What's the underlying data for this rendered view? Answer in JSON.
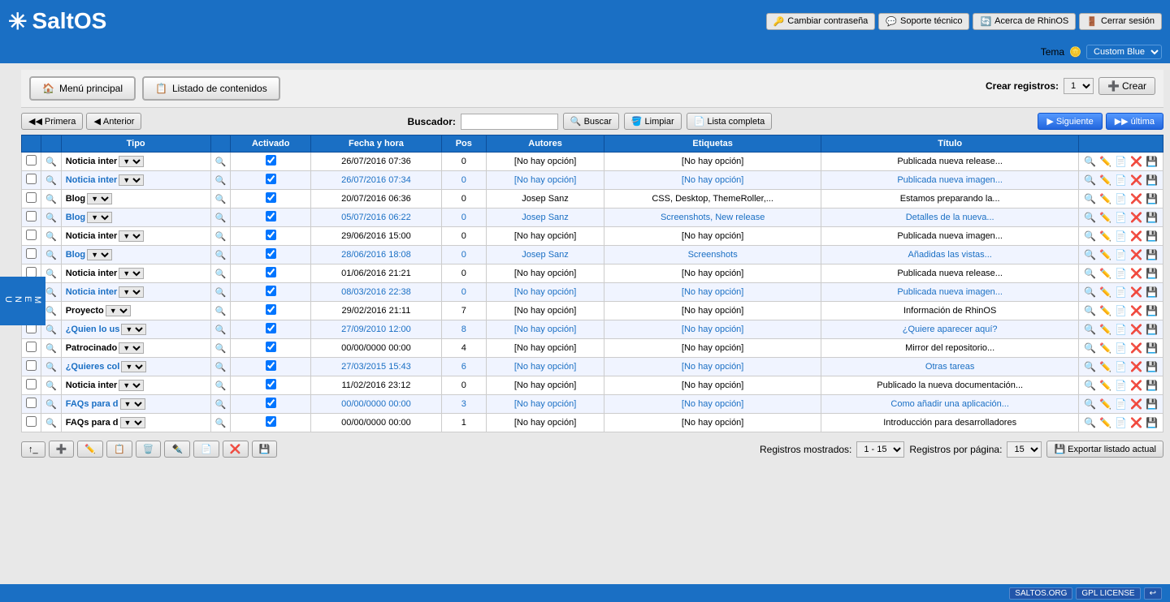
{
  "header": {
    "logo_text": "SaltOS",
    "buttons": [
      {
        "id": "change-pass",
        "label": "Cambiar contraseña",
        "icon": "🔑"
      },
      {
        "id": "support",
        "label": "Soporte técnico",
        "icon": "💬"
      },
      {
        "id": "about",
        "label": "Acerca de RhinOS",
        "icon": "🔄"
      },
      {
        "id": "logout",
        "label": "Cerrar sesión",
        "icon": "🚪"
      }
    ],
    "theme_label": "Tema",
    "theme_value": "Custom Blue"
  },
  "nav": {
    "menu_principal": "Menú principal",
    "listado_contenidos": "Listado de contenidos"
  },
  "side_menu": "MENU",
  "toolbar": {
    "primera": "Primera",
    "anterior": "Anterior",
    "buscar_label": "Buscador:",
    "buscar_btn": "Buscar",
    "limpiar_btn": "Limpiar",
    "lista_completa": "Lista completa",
    "siguiente": "Siguiente",
    "ultima": "última"
  },
  "create_bar": {
    "label": "Crear registros:",
    "value": "1",
    "btn": "Crear"
  },
  "table": {
    "headers": [
      "",
      "",
      "Tipo",
      "",
      "Activado",
      "Fecha y hora",
      "Pos",
      "Autores",
      "Etiquetas",
      "Título",
      ""
    ],
    "rows": [
      {
        "tipo": "Noticia inter",
        "activado": true,
        "fecha": "26/07/2016 07:36",
        "pos": "0",
        "autores": "[No hay opción]",
        "etiquetas": "[No hay opción]",
        "titulo": "Publicada nueva release...",
        "highlight": false
      },
      {
        "tipo": "Noticia inter",
        "activado": true,
        "fecha": "26/07/2016 07:34",
        "pos": "0",
        "autores": "[No hay opción]",
        "etiquetas": "[No hay opción]",
        "titulo": "Publicada nueva imagen...",
        "highlight": true
      },
      {
        "tipo": "Blog",
        "activado": true,
        "fecha": "20/07/2016 06:36",
        "pos": "0",
        "autores": "Josep Sanz",
        "etiquetas": "CSS, Desktop, ThemeRoller,...",
        "titulo": "Estamos preparando la...",
        "highlight": false
      },
      {
        "tipo": "Blog",
        "activado": true,
        "fecha": "05/07/2016 06:22",
        "pos": "0",
        "autores": "Josep Sanz",
        "etiquetas": "Screenshots, New release",
        "titulo": "Detalles de la nueva...",
        "highlight": true
      },
      {
        "tipo": "Noticia inter",
        "activado": true,
        "fecha": "29/06/2016 15:00",
        "pos": "0",
        "autores": "[No hay opción]",
        "etiquetas": "[No hay opción]",
        "titulo": "Publicada nueva imagen...",
        "highlight": false
      },
      {
        "tipo": "Blog",
        "activado": true,
        "fecha": "28/06/2016 18:08",
        "pos": "0",
        "autores": "Josep Sanz",
        "etiquetas": "Screenshots",
        "titulo": "Añadidas las vistas...",
        "highlight": true
      },
      {
        "tipo": "Noticia inter",
        "activado": true,
        "fecha": "01/06/2016 21:21",
        "pos": "0",
        "autores": "[No hay opción]",
        "etiquetas": "[No hay opción]",
        "titulo": "Publicada nueva release...",
        "highlight": false
      },
      {
        "tipo": "Noticia inter",
        "activado": true,
        "fecha": "08/03/2016 22:38",
        "pos": "0",
        "autores": "[No hay opción]",
        "etiquetas": "[No hay opción]",
        "titulo": "Publicada nueva imagen...",
        "highlight": true
      },
      {
        "tipo": "Proyecto",
        "activado": true,
        "fecha": "29/02/2016 21:11",
        "pos": "7",
        "autores": "[No hay opción]",
        "etiquetas": "[No hay opción]",
        "titulo": "Información de RhinOS",
        "highlight": false
      },
      {
        "tipo": "¿Quien lo us",
        "activado": true,
        "fecha": "27/09/2010 12:00",
        "pos": "8",
        "autores": "[No hay opción]",
        "etiquetas": "[No hay opción]",
        "titulo": "¿Quiere aparecer aquí?",
        "highlight": true
      },
      {
        "tipo": "Patrocinado",
        "activado": true,
        "fecha": "00/00/0000 00:00",
        "pos": "4",
        "autores": "[No hay opción]",
        "etiquetas": "[No hay opción]",
        "titulo": "Mirror del repositorio...",
        "highlight": false
      },
      {
        "tipo": "¿Quieres col",
        "activado": true,
        "fecha": "27/03/2015 15:43",
        "pos": "6",
        "autores": "[No hay opción]",
        "etiquetas": "[No hay opción]",
        "titulo": "Otras tareas",
        "highlight": true
      },
      {
        "tipo": "Noticia inter",
        "activado": true,
        "fecha": "11/02/2016 23:12",
        "pos": "0",
        "autores": "[No hay opción]",
        "etiquetas": "[No hay opción]",
        "titulo": "Publicado la nueva documentación...",
        "highlight": false
      },
      {
        "tipo": "FAQs para d",
        "activado": true,
        "fecha": "00/00/0000 00:00",
        "pos": "3",
        "autores": "[No hay opción]",
        "etiquetas": "[No hay opción]",
        "titulo": "Como añadir una aplicación...",
        "highlight": true
      },
      {
        "tipo": "FAQs para d",
        "activado": true,
        "fecha": "00/00/0000 00:00",
        "pos": "1",
        "autores": "[No hay opción]",
        "etiquetas": "[No hay opción]",
        "titulo": "Introducción para desarrolladores",
        "highlight": false
      }
    ]
  },
  "bottom": {
    "reg_mostrados_label": "Registros mostrados:",
    "reg_mostrados_value": "1 - 15",
    "reg_por_pagina_label": "Registros por página:",
    "reg_por_pagina_value": "15",
    "export_btn": "Exportar listado actual",
    "actions": [
      "↑",
      "add",
      "edit",
      "copy",
      "delete",
      "pencil",
      "view",
      "delete2",
      "save"
    ]
  },
  "footer": {
    "badge1": "SALTOS.ORG",
    "badge2": "GPL LICENSE",
    "badge3": "↩"
  }
}
